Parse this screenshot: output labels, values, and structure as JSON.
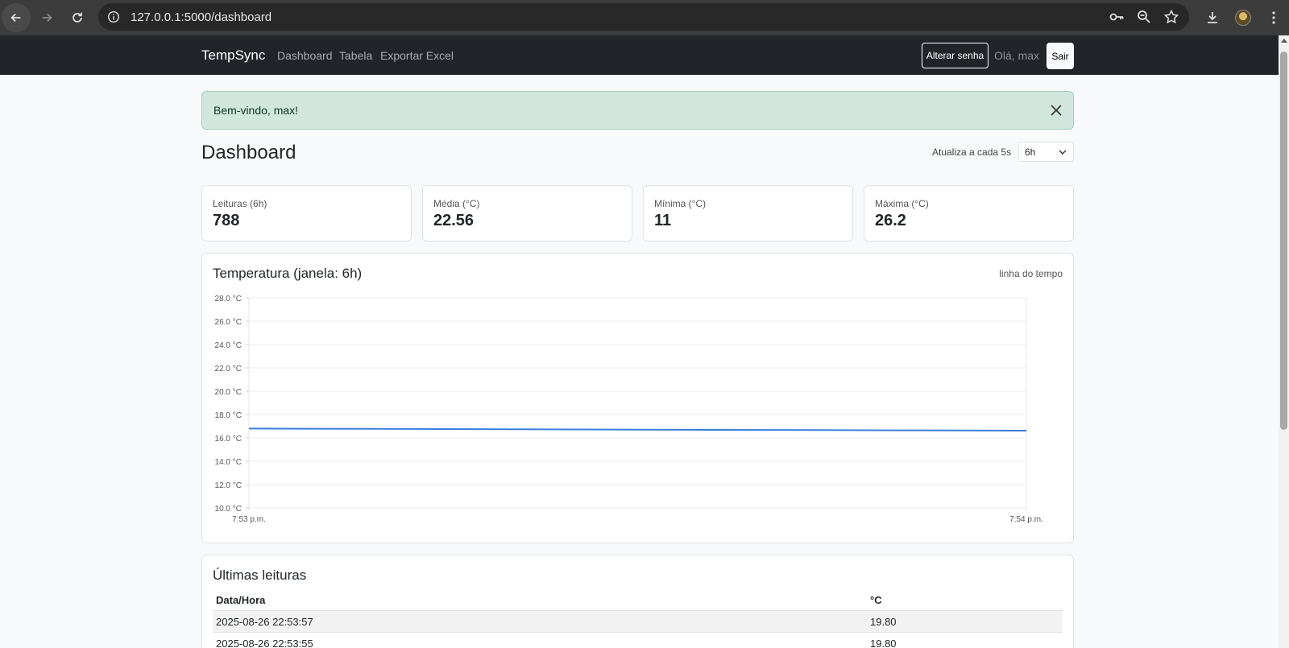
{
  "browser": {
    "url": "127.0.0.1:5000/dashboard"
  },
  "navbar": {
    "brand": "TempSync",
    "links": [
      "Dashboard",
      "Tabela",
      "Exportar Excel"
    ],
    "change_password": "Alterar senha",
    "greeting": "Olá, max",
    "logout": "Sair"
  },
  "alert": {
    "message": "Bem-vindo, max!"
  },
  "header": {
    "title": "Dashboard",
    "refresh_text": "Atualiza a cada 5s",
    "window_select": "6h"
  },
  "stats": [
    {
      "label": "Leituras (6h)",
      "value": "788"
    },
    {
      "label": "Média (°C)",
      "value": "22.56"
    },
    {
      "label": "Mínima (°C)",
      "value": "11"
    },
    {
      "label": "Máxima (°C)",
      "value": "26.2"
    }
  ],
  "chart_card": {
    "title": "Temperatura (janela: 6h)",
    "subtitle": "linha do tempo"
  },
  "chart_data": {
    "type": "line",
    "title": "Temperatura (janela: 6h)",
    "xlabel": "",
    "ylabel": "",
    "x_ticks": [
      "7:53 p.m.",
      "7:54 p.m."
    ],
    "y_ticks": [
      "10.0 °C",
      "12.0 °C",
      "14.0 °C",
      "16.0 °C",
      "18.0 °C",
      "20.0 °C",
      "22.0 °C",
      "24.0 °C",
      "26.0 °C",
      "28.0 °C"
    ],
    "ylim": [
      10,
      28
    ],
    "grid": true,
    "line_color": "#3b7ddd",
    "series": [
      {
        "values": [
          16.8,
          16.77,
          16.74,
          16.71,
          16.68,
          16.65,
          16.62
        ]
      }
    ]
  },
  "table_card": {
    "title": "Últimas leituras",
    "columns": [
      "Data/Hora",
      "°C"
    ],
    "rows": [
      [
        "2025-08-26 22:53:57",
        "19.80"
      ],
      [
        "2025-08-26 22:53:55",
        "19.80"
      ]
    ]
  }
}
